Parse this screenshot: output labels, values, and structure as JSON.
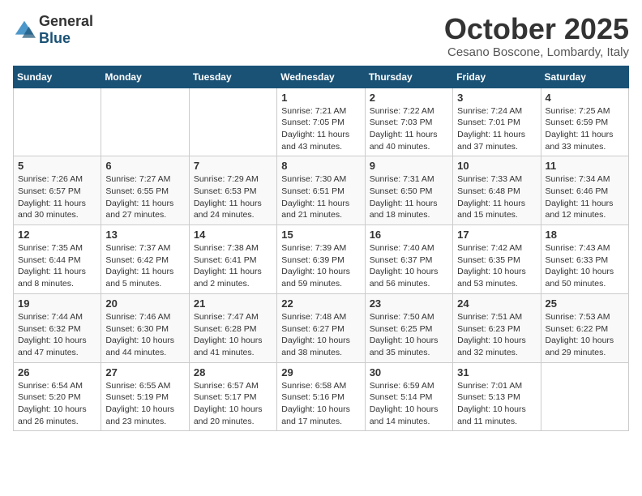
{
  "header": {
    "logo_general": "General",
    "logo_blue": "Blue",
    "month_title": "October 2025",
    "subtitle": "Cesano Boscone, Lombardy, Italy"
  },
  "weekdays": [
    "Sunday",
    "Monday",
    "Tuesday",
    "Wednesday",
    "Thursday",
    "Friday",
    "Saturday"
  ],
  "weeks": [
    [
      {
        "day": "",
        "info": ""
      },
      {
        "day": "",
        "info": ""
      },
      {
        "day": "",
        "info": ""
      },
      {
        "day": "1",
        "info": "Sunrise: 7:21 AM\nSunset: 7:05 PM\nDaylight: 11 hours\nand 43 minutes."
      },
      {
        "day": "2",
        "info": "Sunrise: 7:22 AM\nSunset: 7:03 PM\nDaylight: 11 hours\nand 40 minutes."
      },
      {
        "day": "3",
        "info": "Sunrise: 7:24 AM\nSunset: 7:01 PM\nDaylight: 11 hours\nand 37 minutes."
      },
      {
        "day": "4",
        "info": "Sunrise: 7:25 AM\nSunset: 6:59 PM\nDaylight: 11 hours\nand 33 minutes."
      }
    ],
    [
      {
        "day": "5",
        "info": "Sunrise: 7:26 AM\nSunset: 6:57 PM\nDaylight: 11 hours\nand 30 minutes."
      },
      {
        "day": "6",
        "info": "Sunrise: 7:27 AM\nSunset: 6:55 PM\nDaylight: 11 hours\nand 27 minutes."
      },
      {
        "day": "7",
        "info": "Sunrise: 7:29 AM\nSunset: 6:53 PM\nDaylight: 11 hours\nand 24 minutes."
      },
      {
        "day": "8",
        "info": "Sunrise: 7:30 AM\nSunset: 6:51 PM\nDaylight: 11 hours\nand 21 minutes."
      },
      {
        "day": "9",
        "info": "Sunrise: 7:31 AM\nSunset: 6:50 PM\nDaylight: 11 hours\nand 18 minutes."
      },
      {
        "day": "10",
        "info": "Sunrise: 7:33 AM\nSunset: 6:48 PM\nDaylight: 11 hours\nand 15 minutes."
      },
      {
        "day": "11",
        "info": "Sunrise: 7:34 AM\nSunset: 6:46 PM\nDaylight: 11 hours\nand 12 minutes."
      }
    ],
    [
      {
        "day": "12",
        "info": "Sunrise: 7:35 AM\nSunset: 6:44 PM\nDaylight: 11 hours\nand 8 minutes."
      },
      {
        "day": "13",
        "info": "Sunrise: 7:37 AM\nSunset: 6:42 PM\nDaylight: 11 hours\nand 5 minutes."
      },
      {
        "day": "14",
        "info": "Sunrise: 7:38 AM\nSunset: 6:41 PM\nDaylight: 11 hours\nand 2 minutes."
      },
      {
        "day": "15",
        "info": "Sunrise: 7:39 AM\nSunset: 6:39 PM\nDaylight: 10 hours\nand 59 minutes."
      },
      {
        "day": "16",
        "info": "Sunrise: 7:40 AM\nSunset: 6:37 PM\nDaylight: 10 hours\nand 56 minutes."
      },
      {
        "day": "17",
        "info": "Sunrise: 7:42 AM\nSunset: 6:35 PM\nDaylight: 10 hours\nand 53 minutes."
      },
      {
        "day": "18",
        "info": "Sunrise: 7:43 AM\nSunset: 6:33 PM\nDaylight: 10 hours\nand 50 minutes."
      }
    ],
    [
      {
        "day": "19",
        "info": "Sunrise: 7:44 AM\nSunset: 6:32 PM\nDaylight: 10 hours\nand 47 minutes."
      },
      {
        "day": "20",
        "info": "Sunrise: 7:46 AM\nSunset: 6:30 PM\nDaylight: 10 hours\nand 44 minutes."
      },
      {
        "day": "21",
        "info": "Sunrise: 7:47 AM\nSunset: 6:28 PM\nDaylight: 10 hours\nand 41 minutes."
      },
      {
        "day": "22",
        "info": "Sunrise: 7:48 AM\nSunset: 6:27 PM\nDaylight: 10 hours\nand 38 minutes."
      },
      {
        "day": "23",
        "info": "Sunrise: 7:50 AM\nSunset: 6:25 PM\nDaylight: 10 hours\nand 35 minutes."
      },
      {
        "day": "24",
        "info": "Sunrise: 7:51 AM\nSunset: 6:23 PM\nDaylight: 10 hours\nand 32 minutes."
      },
      {
        "day": "25",
        "info": "Sunrise: 7:53 AM\nSunset: 6:22 PM\nDaylight: 10 hours\nand 29 minutes."
      }
    ],
    [
      {
        "day": "26",
        "info": "Sunrise: 6:54 AM\nSunset: 5:20 PM\nDaylight: 10 hours\nand 26 minutes."
      },
      {
        "day": "27",
        "info": "Sunrise: 6:55 AM\nSunset: 5:19 PM\nDaylight: 10 hours\nand 23 minutes."
      },
      {
        "day": "28",
        "info": "Sunrise: 6:57 AM\nSunset: 5:17 PM\nDaylight: 10 hours\nand 20 minutes."
      },
      {
        "day": "29",
        "info": "Sunrise: 6:58 AM\nSunset: 5:16 PM\nDaylight: 10 hours\nand 17 minutes."
      },
      {
        "day": "30",
        "info": "Sunrise: 6:59 AM\nSunset: 5:14 PM\nDaylight: 10 hours\nand 14 minutes."
      },
      {
        "day": "31",
        "info": "Sunrise: 7:01 AM\nSunset: 5:13 PM\nDaylight: 10 hours\nand 11 minutes."
      },
      {
        "day": "",
        "info": ""
      }
    ]
  ]
}
